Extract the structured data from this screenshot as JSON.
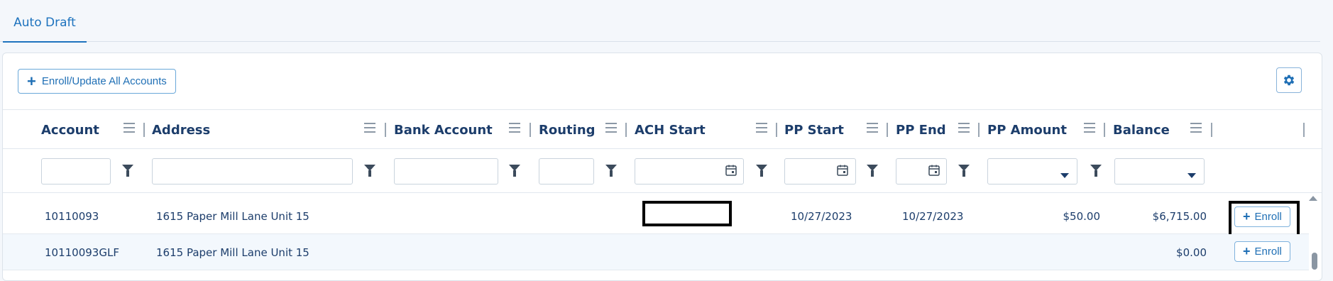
{
  "tabs": [
    {
      "label": "Auto Draft",
      "active": true
    }
  ],
  "toolbar": {
    "enroll_all_label": "Enroll/Update All Accounts",
    "settings_icon": "gear-icon"
  },
  "columns": [
    {
      "key": "account",
      "label": "Account"
    },
    {
      "key": "address",
      "label": "Address"
    },
    {
      "key": "bank_account",
      "label": "Bank Account"
    },
    {
      "key": "routing",
      "label": "Routing"
    },
    {
      "key": "ach_start",
      "label": "ACH Start"
    },
    {
      "key": "pp_start",
      "label": "PP Start"
    },
    {
      "key": "pp_end",
      "label": "PP End"
    },
    {
      "key": "pp_amount",
      "label": "PP Amount"
    },
    {
      "key": "balance",
      "label": "Balance"
    }
  ],
  "rows": [
    {
      "account": "10110093",
      "address": "1615 Paper Mill Lane Unit 15",
      "bank_account": "",
      "routing": "",
      "ach_start": "",
      "ach_start_redacted": true,
      "pp_start": "10/27/2023",
      "pp_end": "10/27/2023",
      "pp_amount": "$50.00",
      "balance": "$6,715.00",
      "action_label": "Enroll",
      "action_highlighted": true
    },
    {
      "account": "10110093GLF",
      "address": "1615 Paper Mill Lane Unit 15",
      "bank_account": "",
      "routing": "",
      "ach_start": "",
      "ach_start_redacted": false,
      "pp_start": "",
      "pp_end": "",
      "pp_amount": "",
      "balance": "$0.00",
      "action_label": "Enroll",
      "action_highlighted": false
    }
  ],
  "colors": {
    "accent": "#1f6fb5",
    "header_text": "#1c3d6b",
    "background": "#f4f7fb"
  }
}
